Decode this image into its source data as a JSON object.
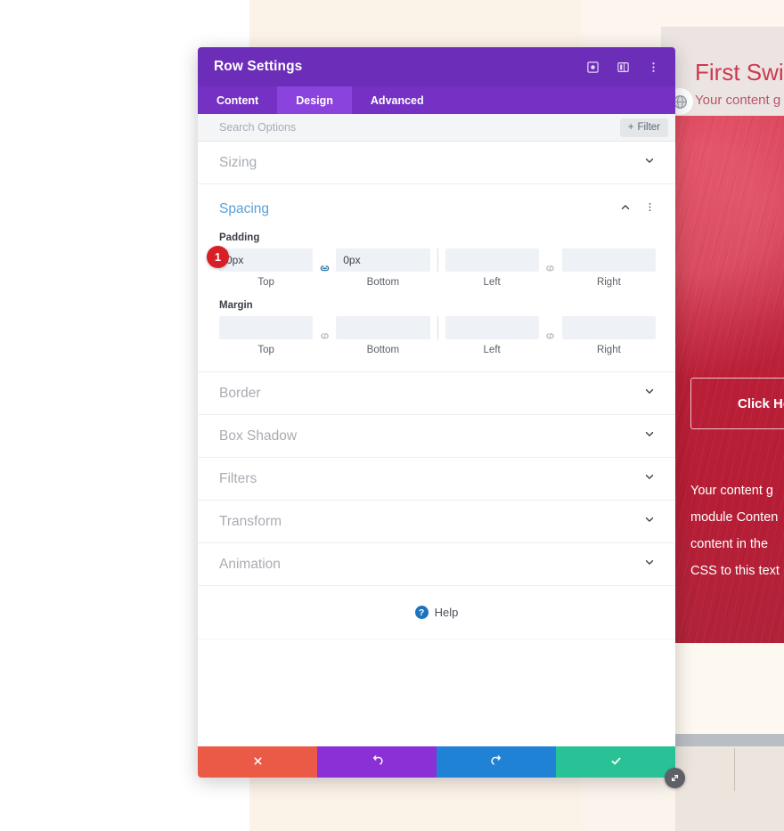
{
  "modal": {
    "title": "Row Settings",
    "header_icons": [
      {
        "name": "focus-icon"
      },
      {
        "name": "split-layout-icon"
      },
      {
        "name": "more-vertical-icon"
      }
    ],
    "tabs": [
      {
        "label": "Content",
        "active": false
      },
      {
        "label": "Design",
        "active": true
      },
      {
        "label": "Advanced",
        "active": false
      }
    ],
    "search": {
      "placeholder": "Search Options",
      "value": ""
    },
    "filter_button": {
      "label": "Filter",
      "icon": "plus-icon"
    },
    "sections": [
      {
        "label": "Sizing",
        "open": false
      },
      {
        "label": "Spacing",
        "open": true
      },
      {
        "label": "Border",
        "open": false
      },
      {
        "label": "Box Shadow",
        "open": false
      },
      {
        "label": "Filters",
        "open": false
      },
      {
        "label": "Transform",
        "open": false
      },
      {
        "label": "Animation",
        "open": false
      }
    ],
    "spacing": {
      "title": "Spacing",
      "badge": "1",
      "padding": {
        "label": "Padding",
        "top": {
          "value": "0px",
          "caption": "Top"
        },
        "bottom": {
          "value": "0px",
          "caption": "Bottom"
        },
        "left": {
          "value": "",
          "caption": "Left"
        },
        "right": {
          "value": "",
          "caption": "Right"
        },
        "link_tb": "linked",
        "link_lr": "unlinked"
      },
      "margin": {
        "label": "Margin",
        "top": {
          "value": "",
          "caption": "Top"
        },
        "bottom": {
          "value": "",
          "caption": "Bottom"
        },
        "left": {
          "value": "",
          "caption": "Left"
        },
        "right": {
          "value": "",
          "caption": "Right"
        },
        "link_tb": "unlinked",
        "link_lr": "unlinked"
      }
    },
    "help": {
      "label": "Help",
      "icon": "question-circle-icon"
    },
    "footer_buttons": [
      {
        "name": "cancel-button",
        "icon": "close-icon",
        "color": "#ea5a47"
      },
      {
        "name": "undo-button",
        "icon": "undo-icon",
        "color": "#8b2fd6"
      },
      {
        "name": "redo-button",
        "icon": "redo-icon",
        "color": "#2082d4"
      },
      {
        "name": "save-button",
        "icon": "checkmark-icon",
        "color": "#28c296"
      }
    ],
    "resize_handle": {
      "icon": "resize-diagonal-icon"
    }
  },
  "background": {
    "hero_title": "First Swip",
    "hero_subtitle": "Your content g",
    "globe_icon": "globe-icon",
    "click_button": "Click He",
    "body_lines": [
      "Your content g",
      "module Conten",
      "content in the",
      "CSS to this text"
    ]
  },
  "colors": {
    "header_purple": "#6c2eb9",
    "tab_bar_purple": "#7431c4",
    "tab_active_purple": "#8a43dd",
    "section_open_blue": "#5b9fd6",
    "badge_red": "#d81f26",
    "panel_red": "#c4293f"
  }
}
